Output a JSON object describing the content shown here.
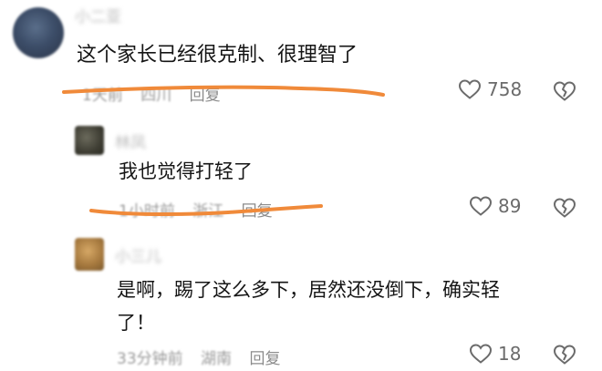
{
  "comments": [
    {
      "username": "小二亚",
      "text": "这个家长已经很克制、很理智了",
      "time": "1天前",
      "location": "四川",
      "reply_label": "回复",
      "likes": "758"
    },
    {
      "username": "林凤",
      "text": "我也觉得打轻了",
      "time": "1小时前",
      "location": "浙江",
      "reply_label": "回复",
      "likes": "89"
    },
    {
      "username": "小三儿",
      "text_line1": "是啊，踢了这么多下，居然还没倒下，确实轻",
      "text_line2": "了！",
      "time": "33分钟前",
      "location": "湖南",
      "reply_label": "回复",
      "likes": "18"
    }
  ],
  "colors": {
    "highlight_underline": "#f08a3a",
    "icon_gray": "#6b6b6b"
  },
  "icons": [
    "heart-icon",
    "broken-heart-icon"
  ]
}
